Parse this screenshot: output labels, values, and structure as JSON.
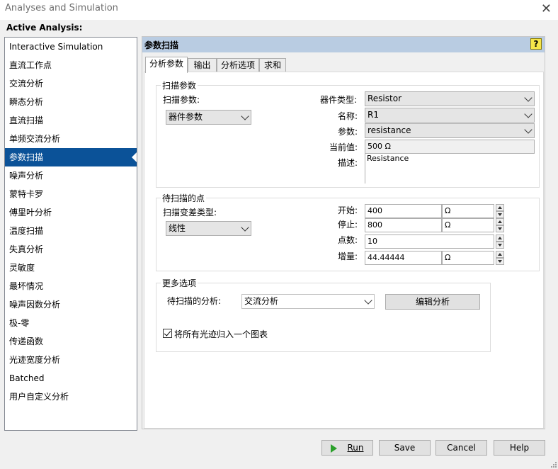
{
  "window": {
    "title": "Analyses and Simulation"
  },
  "active_analysis_label": "Active Analysis:",
  "analyses": [
    "Interactive Simulation",
    "直流工作点",
    "交流分析",
    "瞬态分析",
    "直流扫描",
    "单频交流分析",
    "参数扫描",
    "噪声分析",
    "蒙特卡罗",
    "傅里叶分析",
    "温度扫描",
    "失真分析",
    "灵敏度",
    "最坏情况",
    "噪声因数分析",
    "极-零",
    "传递函数",
    "光迹宽度分析",
    "Batched",
    "用户自定义分析"
  ],
  "selected_index": 6,
  "panel": {
    "title": "参数扫描",
    "help_icon": "?",
    "tabs": [
      "分析参数",
      "输出",
      "分析选项",
      "求和"
    ],
    "sweep_params": {
      "legend": "扫描参数",
      "sweep_param_label": "扫描参数:",
      "sweep_param_value": "器件参数",
      "device_type_label": "器件类型:",
      "device_type_value": "Resistor",
      "name_label": "名称:",
      "name_value": "R1",
      "parameter_label": "参数:",
      "parameter_value": "resistance",
      "present_value_label": "当前值:",
      "present_value": "500 Ω",
      "description_label": "描述:",
      "description_value": "Resistance"
    },
    "points": {
      "legend": "待扫描的点",
      "variation_label": "扫描变差类型:",
      "variation_value": "线性",
      "start_label": "开始:",
      "start_value": "400",
      "start_unit": "Ω",
      "stop_label": "停止:",
      "stop_value": "800",
      "stop_unit": "Ω",
      "num_points_label": "点数:",
      "num_points_value": "10",
      "increment_label": "增量:",
      "increment_value": "44.44444",
      "increment_unit": "Ω"
    },
    "more_options": {
      "legend": "更多选项",
      "analysis_label": "待扫描的分析:",
      "analysis_value": "交流分析",
      "edit_button": "编辑分析",
      "group_traces_label": "将所有光迹归入一个图表",
      "group_traces_checked": true
    }
  },
  "buttons": {
    "run": "Run",
    "save": "Save",
    "cancel": "Cancel",
    "help": "Help"
  },
  "colors": {
    "selection": "#0b5298",
    "header": "#b9cce2",
    "run_icon": "#2aa02a"
  }
}
